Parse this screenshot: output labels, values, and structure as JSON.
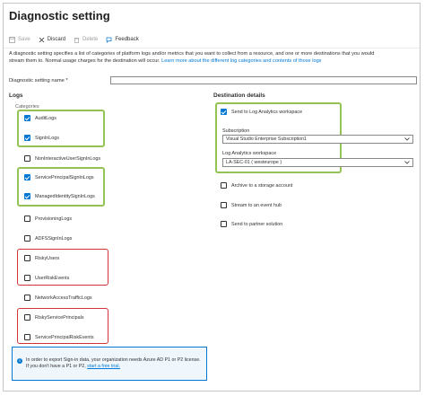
{
  "header": {
    "title": "Diagnostic setting",
    "more": "···"
  },
  "toolbar": {
    "save": "Save",
    "discard": "Discard",
    "delete": "Delete",
    "feedback": "Feedback"
  },
  "description": {
    "text": "A diagnostic setting specifies a list of categories of platform logs and/or metrics that you want to collect from a resource, and one or more destinations that you would stream them to. Normal usage charges for the destination will occur.",
    "link": "Learn more about the different log categories and contents of those logs"
  },
  "name_field": {
    "label": "Diagnostic setting name *",
    "value": ""
  },
  "logs": {
    "heading": "Logs",
    "categories_label": "Categories",
    "items": [
      {
        "label": "AuditLogs",
        "checked": true
      },
      {
        "label": "SignInLogs",
        "checked": true
      },
      {
        "label": "NonInteractiveUserSignInLogs",
        "checked": false
      },
      {
        "label": "ServicePrincipalSignInLogs",
        "checked": true
      },
      {
        "label": "ManagedIdentitySignInLogs",
        "checked": true
      },
      {
        "label": "ProvisioningLogs",
        "checked": false
      },
      {
        "label": "ADFSSignInLogs",
        "checked": false
      },
      {
        "label": "RiskyUsers",
        "checked": false
      },
      {
        "label": "UserRiskEvents",
        "checked": false
      },
      {
        "label": "NetworkAccessTrafficLogs",
        "checked": false
      },
      {
        "label": "RiskyServicePrincipals",
        "checked": false
      },
      {
        "label": "ServicePrincipalRiskEvents",
        "checked": false
      }
    ]
  },
  "destination": {
    "heading": "Destination details",
    "log_analytics": {
      "label": "Send to Log Analytics workspace",
      "checked": true
    },
    "subscription": {
      "label": "Subscription",
      "value": "Visual Studio Enterprise Subscription1"
    },
    "workspace": {
      "label": "Log Analytics workspace",
      "value": "LA-SEC-01 ( westeurope )"
    },
    "storage": {
      "label": "Archive to a storage account",
      "checked": false
    },
    "event_hub": {
      "label": "Stream to an event hub",
      "checked": false
    },
    "partner": {
      "label": "Send to partner solution",
      "checked": false
    }
  },
  "info": {
    "text": "In order to export Sign-in data, your organization needs Azure AD P1 or P2 license. If you don't have a P1 or P2,",
    "link": "start a free trial."
  },
  "colors": {
    "accent": "#0078d4",
    "green_highlight": "#92c353",
    "red_highlight": "#d13438"
  }
}
